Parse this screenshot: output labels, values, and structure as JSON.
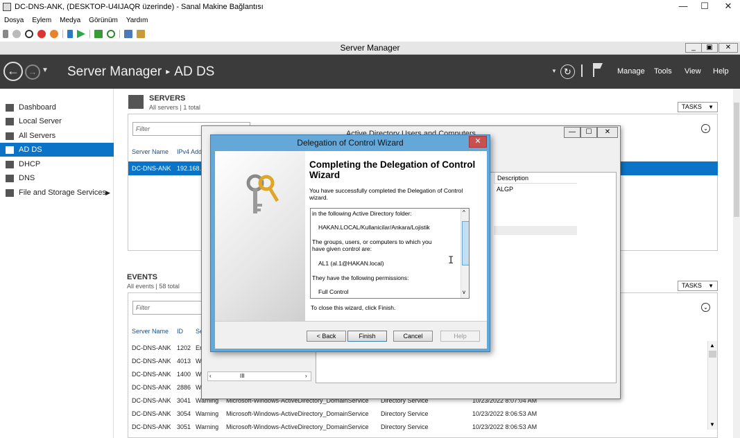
{
  "vm": {
    "title": "DC-DNS-ANK, (DESKTOP-U4IJAQR üzerinde) - Sanal Makine Bağlantısı",
    "menus": [
      "Dosya",
      "Eylem",
      "Medya",
      "Görünüm",
      "Yardım"
    ],
    "controls": {
      "minimize": "—",
      "maximize": "☐",
      "close": "✕"
    },
    "toolbar_icons": [
      "ctrl-alt-del-icon",
      "start-icon",
      "turn-off-icon",
      "shutdown-icon",
      "save-icon",
      "pause-icon",
      "resume-icon",
      "checkpoint-icon",
      "revert-icon",
      "enhanced-session-icon",
      "share-icon"
    ]
  },
  "sm": {
    "window_title": "Server Manager",
    "controls": {
      "minimize": "_",
      "maximize": "▣",
      "close": "✕"
    },
    "breadcrumb": {
      "root": "Server Manager",
      "separator": "▸",
      "current": "AD DS"
    },
    "header_menus": [
      "Manage",
      "Tools",
      "View",
      "Help"
    ],
    "sidebar": [
      {
        "label": "Dashboard",
        "icon": "dashboard-icon"
      },
      {
        "label": "Local Server",
        "icon": "local-server-icon"
      },
      {
        "label": "All Servers",
        "icon": "all-servers-icon"
      },
      {
        "label": "AD DS",
        "icon": "ad-ds-icon",
        "active": true
      },
      {
        "label": "DHCP",
        "icon": "dhcp-icon"
      },
      {
        "label": "DNS",
        "icon": "dns-icon"
      },
      {
        "label": "File and Storage Services",
        "icon": "file-storage-icon",
        "arrow": "▶"
      }
    ],
    "servers": {
      "title": "SERVERS",
      "subtitle": "All servers | 1 total",
      "tasks": "TASKS",
      "filter_placeholder": "Filter",
      "columns": [
        "Server Name",
        "IPv4 Add"
      ],
      "row": [
        "DC-DNS-ANK",
        "192.168."
      ]
    },
    "events": {
      "title": "EVENTS",
      "subtitle": "All events | 58 total",
      "tasks": "TASKS",
      "filter_placeholder": "Filter",
      "columns": [
        "Server Name",
        "ID",
        "Se"
      ],
      "rows": [
        [
          "DC-DNS-ANK",
          "1202",
          "Er",
          "",
          "",
          ""
        ],
        [
          "DC-DNS-ANK",
          "4013",
          "W",
          "",
          "",
          ""
        ],
        [
          "DC-DNS-ANK",
          "1400",
          "W",
          "",
          "",
          ""
        ],
        [
          "DC-DNS-ANK",
          "2886",
          "W",
          "",
          "",
          ""
        ],
        [
          "DC-DNS-ANK",
          "3041",
          "Warning",
          "Microsoft-Windows-ActiveDirectory_DomainService",
          "Directory Service",
          "10/23/2022 8:07:04 AM"
        ],
        [
          "DC-DNS-ANK",
          "3054",
          "Warning",
          "Microsoft-Windows-ActiveDirectory_DomainService",
          "Directory Service",
          "10/23/2022 8:06:53 AM"
        ],
        [
          "DC-DNS-ANK",
          "3051",
          "Warning",
          "Microsoft-Windows-ActiveDirectory_DomainService",
          "Directory Service",
          "10/23/2022 8:06:53 AM"
        ]
      ]
    }
  },
  "aduc": {
    "title": "Active Directory Users and Computers",
    "controls": {
      "minimize": "—",
      "maximize": "☐",
      "close": "✕"
    },
    "description_header": "Description",
    "description_value": "ALGP",
    "scroll_thumb": "III"
  },
  "wizard": {
    "title": "Delegation of Control Wizard",
    "close": "✕",
    "heading": "Completing the Delegation of Control Wizard",
    "intro": "You have successfully completed the Delegation of Control wizard.",
    "summary_lines": [
      "in the following Active Directory folder:",
      "HAKAN.LOCAL/Kullanicilar/Ankara/Lojistik",
      "The groups, users, or computers to which you",
      "have given control are:",
      "AL1 (al.1@HAKAN.local)",
      "They have the following permissions:",
      "Full Control"
    ],
    "close_hint": "To close this wizard, click Finish.",
    "buttons": {
      "back": "< Back",
      "finish": "Finish",
      "cancel": "Cancel",
      "help": "Help"
    }
  }
}
